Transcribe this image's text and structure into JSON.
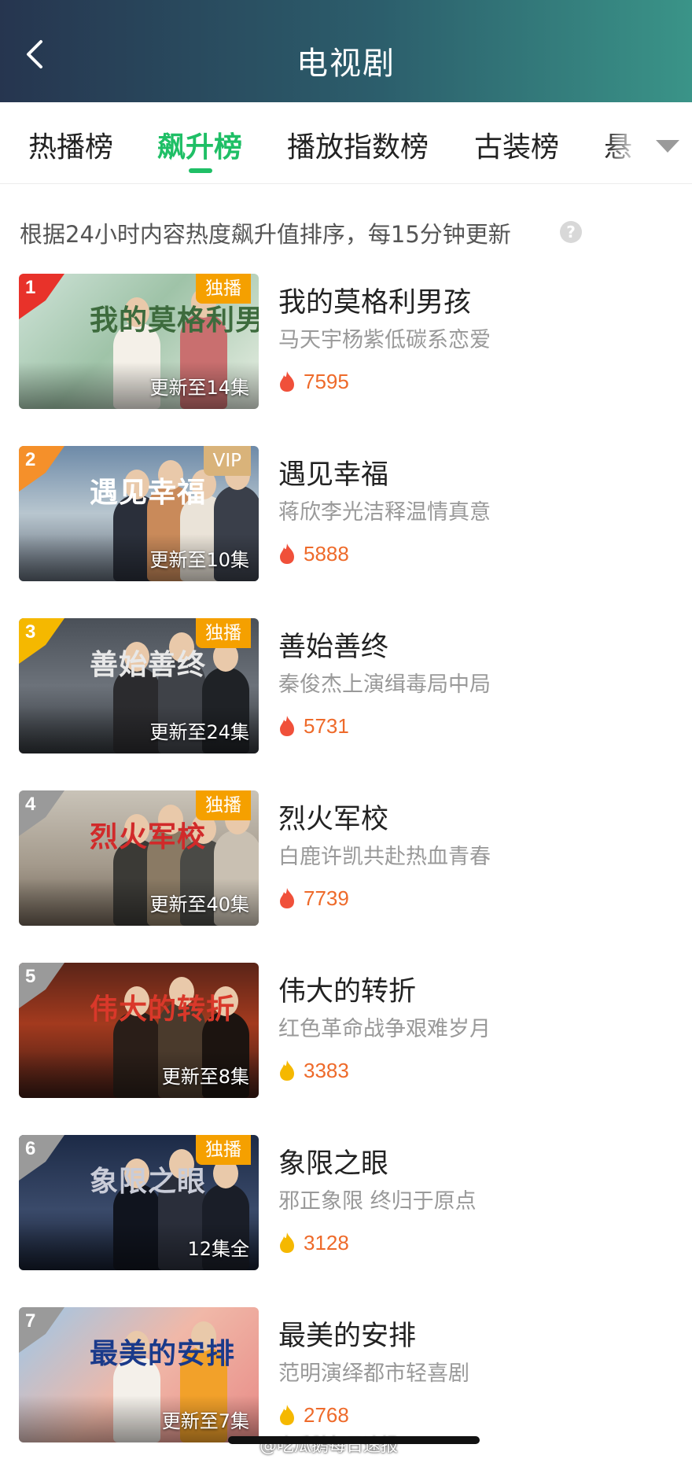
{
  "header": {
    "title": "电视剧",
    "back_icon": "chevron-left-icon"
  },
  "tabs": [
    {
      "label": "热播榜",
      "active": false
    },
    {
      "label": "飙升榜",
      "active": true
    },
    {
      "label": "播放指数榜",
      "active": false
    },
    {
      "label": "古装榜",
      "active": false
    },
    {
      "label": "悬",
      "active": false
    }
  ],
  "tabs_more_icon": "triangle-down-icon",
  "notice": {
    "text": "根据24小时内容热度飙升值排序，每15分钟更新",
    "help_label": "?"
  },
  "colors": {
    "accent": "#1fbf66",
    "heat_text": "#ee6a2a",
    "flame_hot": "#f0503a",
    "flame_warm": "#f5b800",
    "rank1": "#e8322a",
    "rank2": "#f5902a",
    "rank3": "#f5b800",
    "rank_other": "#9a9a9a",
    "tag_exclusive": "#f5a000",
    "tag_vip": "#d9b37a"
  },
  "items": [
    {
      "rank": "1",
      "title": "我的莫格利男孩",
      "desc": "马天宇杨紫低碳系恋爱",
      "heat": "7595",
      "tag": "独播",
      "tag_type": "exclusive",
      "episodes": "更新至14集",
      "poster_text": "我的莫格利男孩",
      "flame": "hot"
    },
    {
      "rank": "2",
      "title": "遇见幸福",
      "desc": "蒋欣李光洁释温情真意",
      "heat": "5888",
      "tag": "VIP",
      "tag_type": "vip",
      "episodes": "更新至10集",
      "poster_text": "遇见幸福",
      "flame": "hot"
    },
    {
      "rank": "3",
      "title": "善始善终",
      "desc": "秦俊杰上演缉毒局中局",
      "heat": "5731",
      "tag": "独播",
      "tag_type": "exclusive",
      "episodes": "更新至24集",
      "poster_text": "善始善终",
      "flame": "hot"
    },
    {
      "rank": "4",
      "title": "烈火军校",
      "desc": "白鹿许凯共赴热血青春",
      "heat": "7739",
      "tag": "独播",
      "tag_type": "exclusive",
      "episodes": "更新至40集",
      "poster_text": "烈火军校",
      "flame": "hot"
    },
    {
      "rank": "5",
      "title": "伟大的转折",
      "desc": "红色革命战争艰难岁月",
      "heat": "3383",
      "tag": "",
      "tag_type": "none",
      "episodes": "更新至8集",
      "poster_text": "伟大的转折",
      "flame": "warm"
    },
    {
      "rank": "6",
      "title": "象限之眼",
      "desc": "邪正象限 终归于原点",
      "heat": "3128",
      "tag": "独播",
      "tag_type": "exclusive",
      "episodes": "12集全",
      "poster_text": "象限之眼",
      "flame": "warm"
    },
    {
      "rank": "7",
      "title": "最美的安排",
      "desc": "范明演绎都市轻喜剧",
      "heat": "2768",
      "tag": "",
      "tag_type": "none",
      "episodes": "更新至7集",
      "poster_text": "最美的安排",
      "flame": "warm"
    }
  ],
  "watermark": "@吃瓜鹅每日速报"
}
